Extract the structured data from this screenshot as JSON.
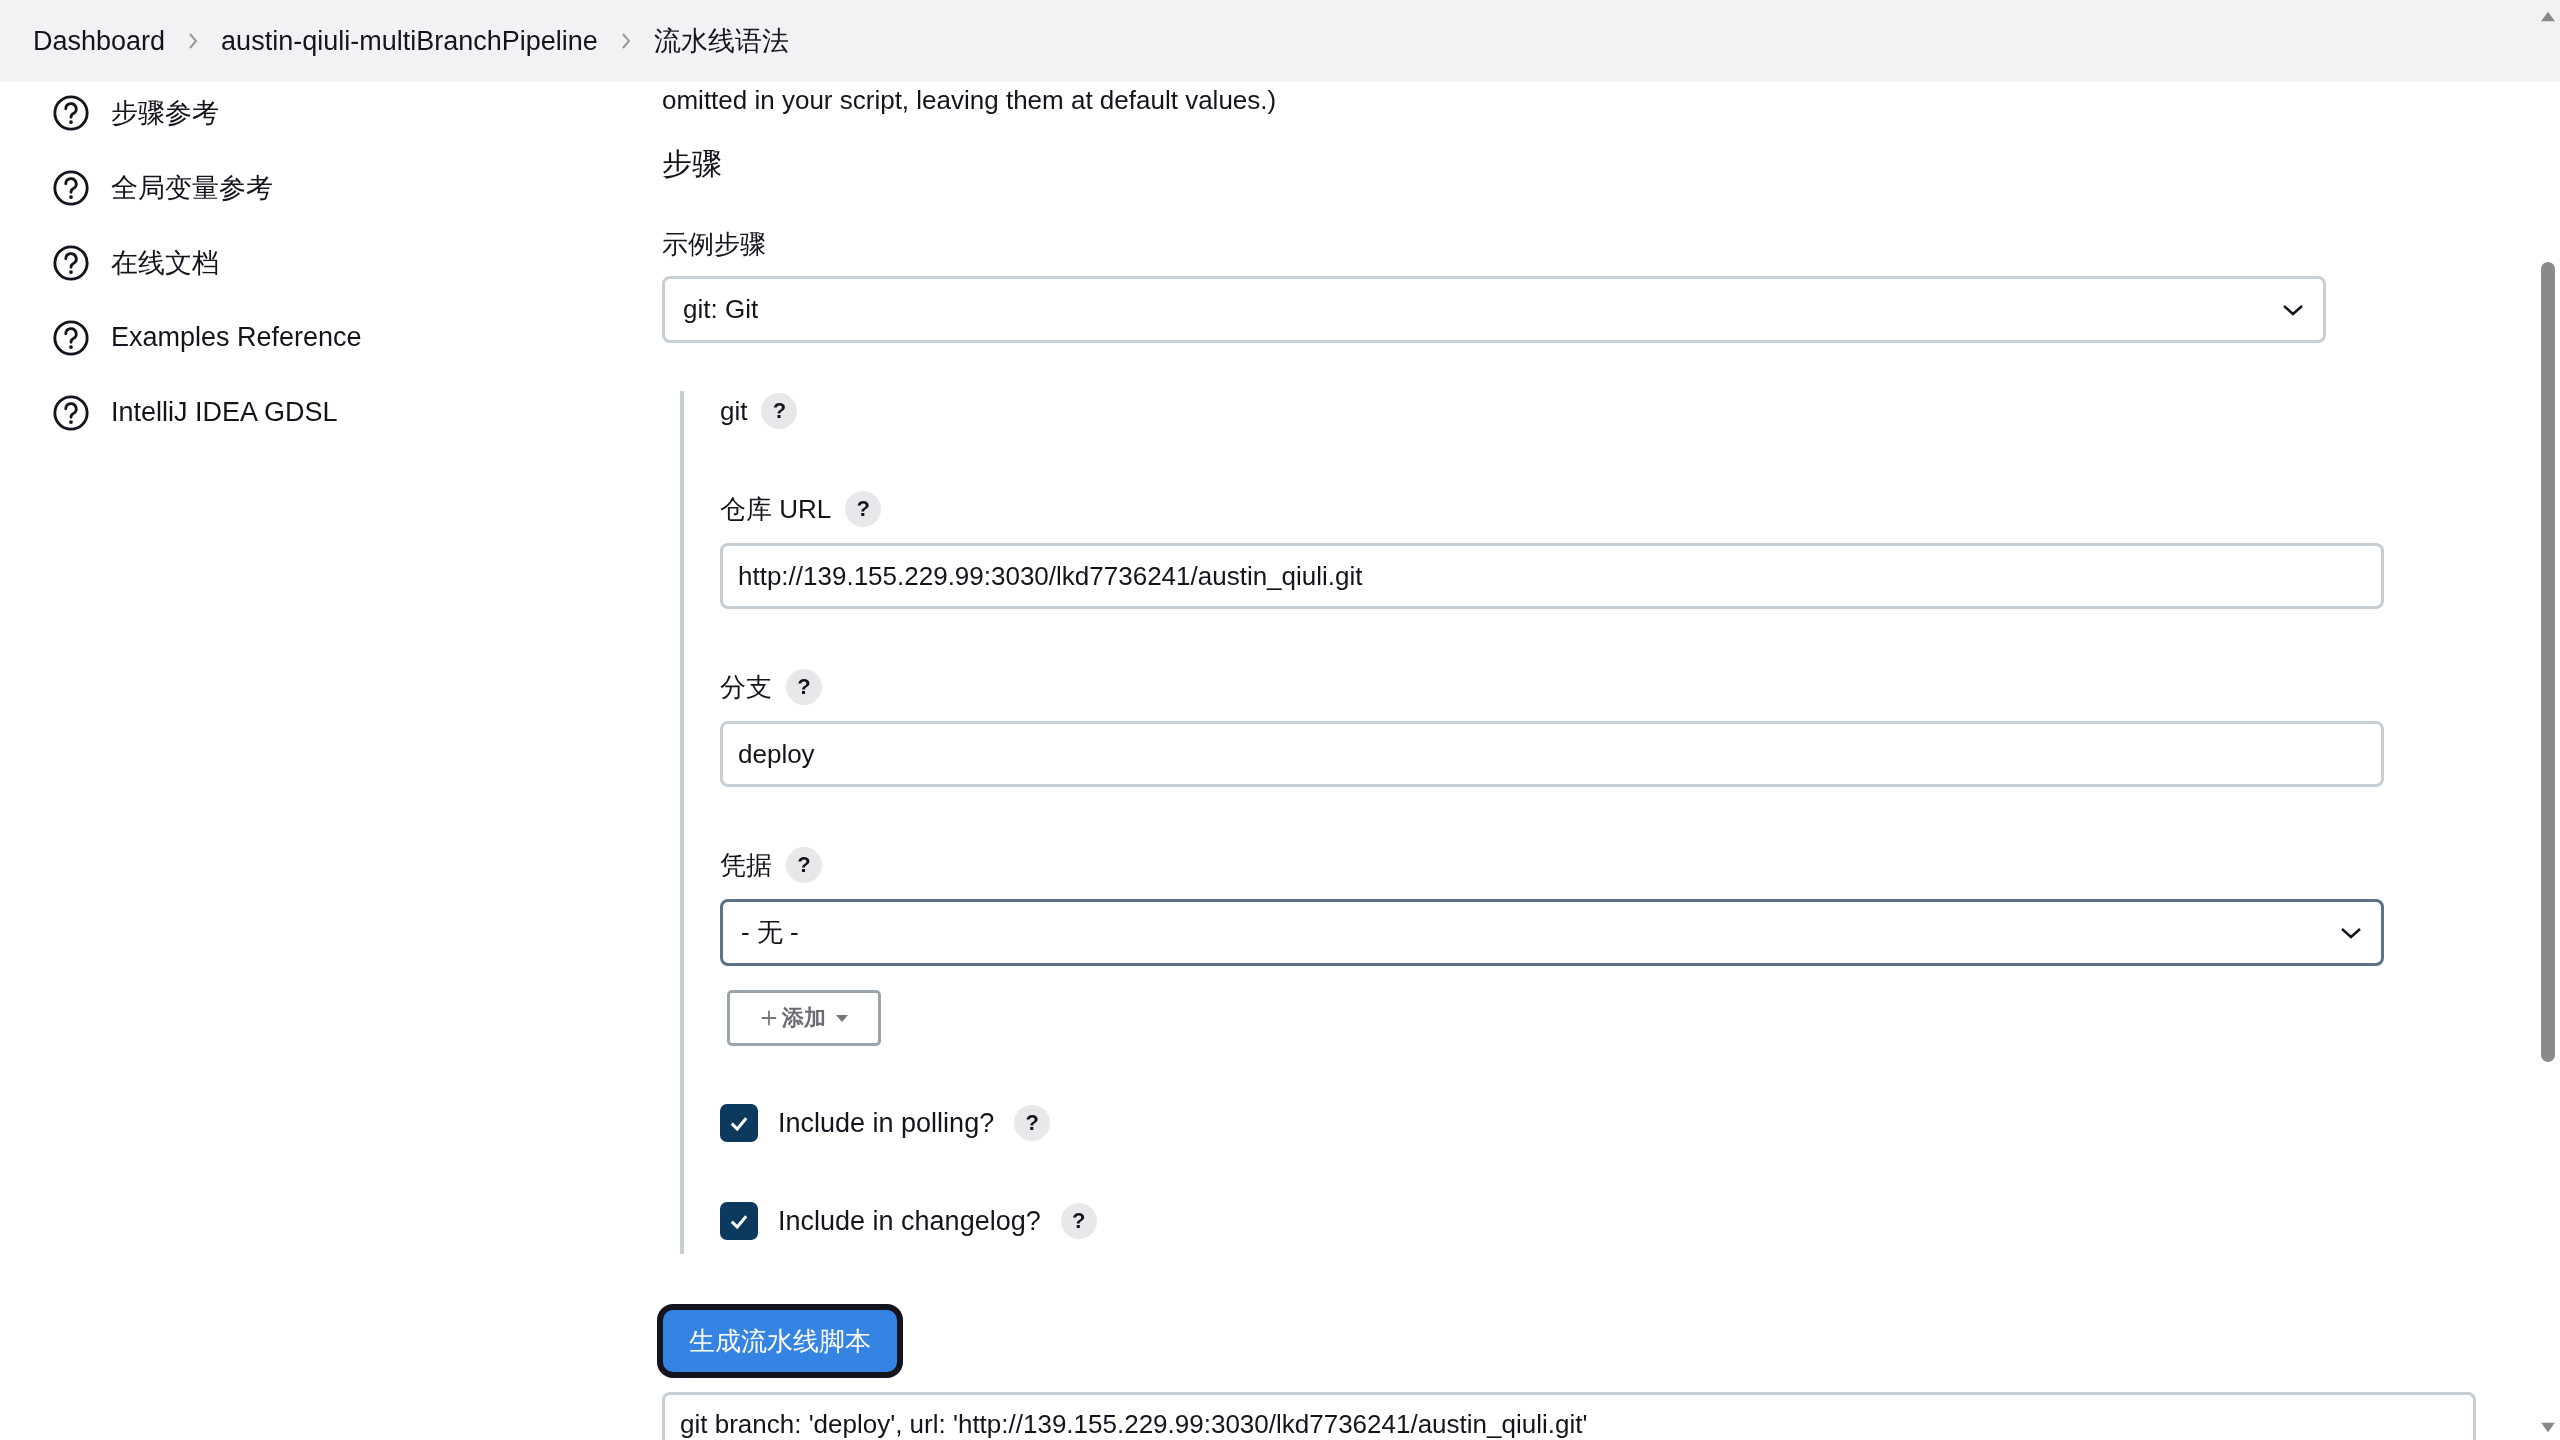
{
  "breadcrumbs": [
    {
      "label": "Dashboard"
    },
    {
      "label": "austin-qiuli-multiBranchPipeline"
    },
    {
      "label": "流水线语法"
    }
  ],
  "sidebar": {
    "items": [
      {
        "label": "步骤参考"
      },
      {
        "label": "全局变量参考"
      },
      {
        "label": "在线文档"
      },
      {
        "label": "Examples Reference"
      },
      {
        "label": "IntelliJ IDEA GDSL"
      }
    ]
  },
  "main": {
    "intro_text": "omitted in your script, leaving them at default values.)",
    "heading": "步骤",
    "sample_step": {
      "label": "示例步骤",
      "value": "git: Git"
    },
    "step": {
      "title": "git",
      "help": "?",
      "fields": [
        {
          "kind": "text",
          "label": "仓库 URL",
          "help": "?",
          "value": "http://139.155.229.99:3030/lkd7736241/austin_qiuli.git"
        },
        {
          "kind": "text",
          "label": "分支",
          "help": "?",
          "value": "deploy"
        },
        {
          "kind": "select",
          "label": "凭据",
          "help": "?",
          "value": "- 无 -",
          "add_button": "添加"
        }
      ],
      "checkboxes": [
        {
          "label": "Include in polling?",
          "help": "?",
          "checked": true
        },
        {
          "label": "Include in changelog?",
          "help": "?",
          "checked": true
        }
      ]
    },
    "generate_button": "生成流水线脚本",
    "output": "git branch: 'deploy', url: 'http://139.155.229.99:3030/lkd7736241/austin_qiuli.git'"
  }
}
